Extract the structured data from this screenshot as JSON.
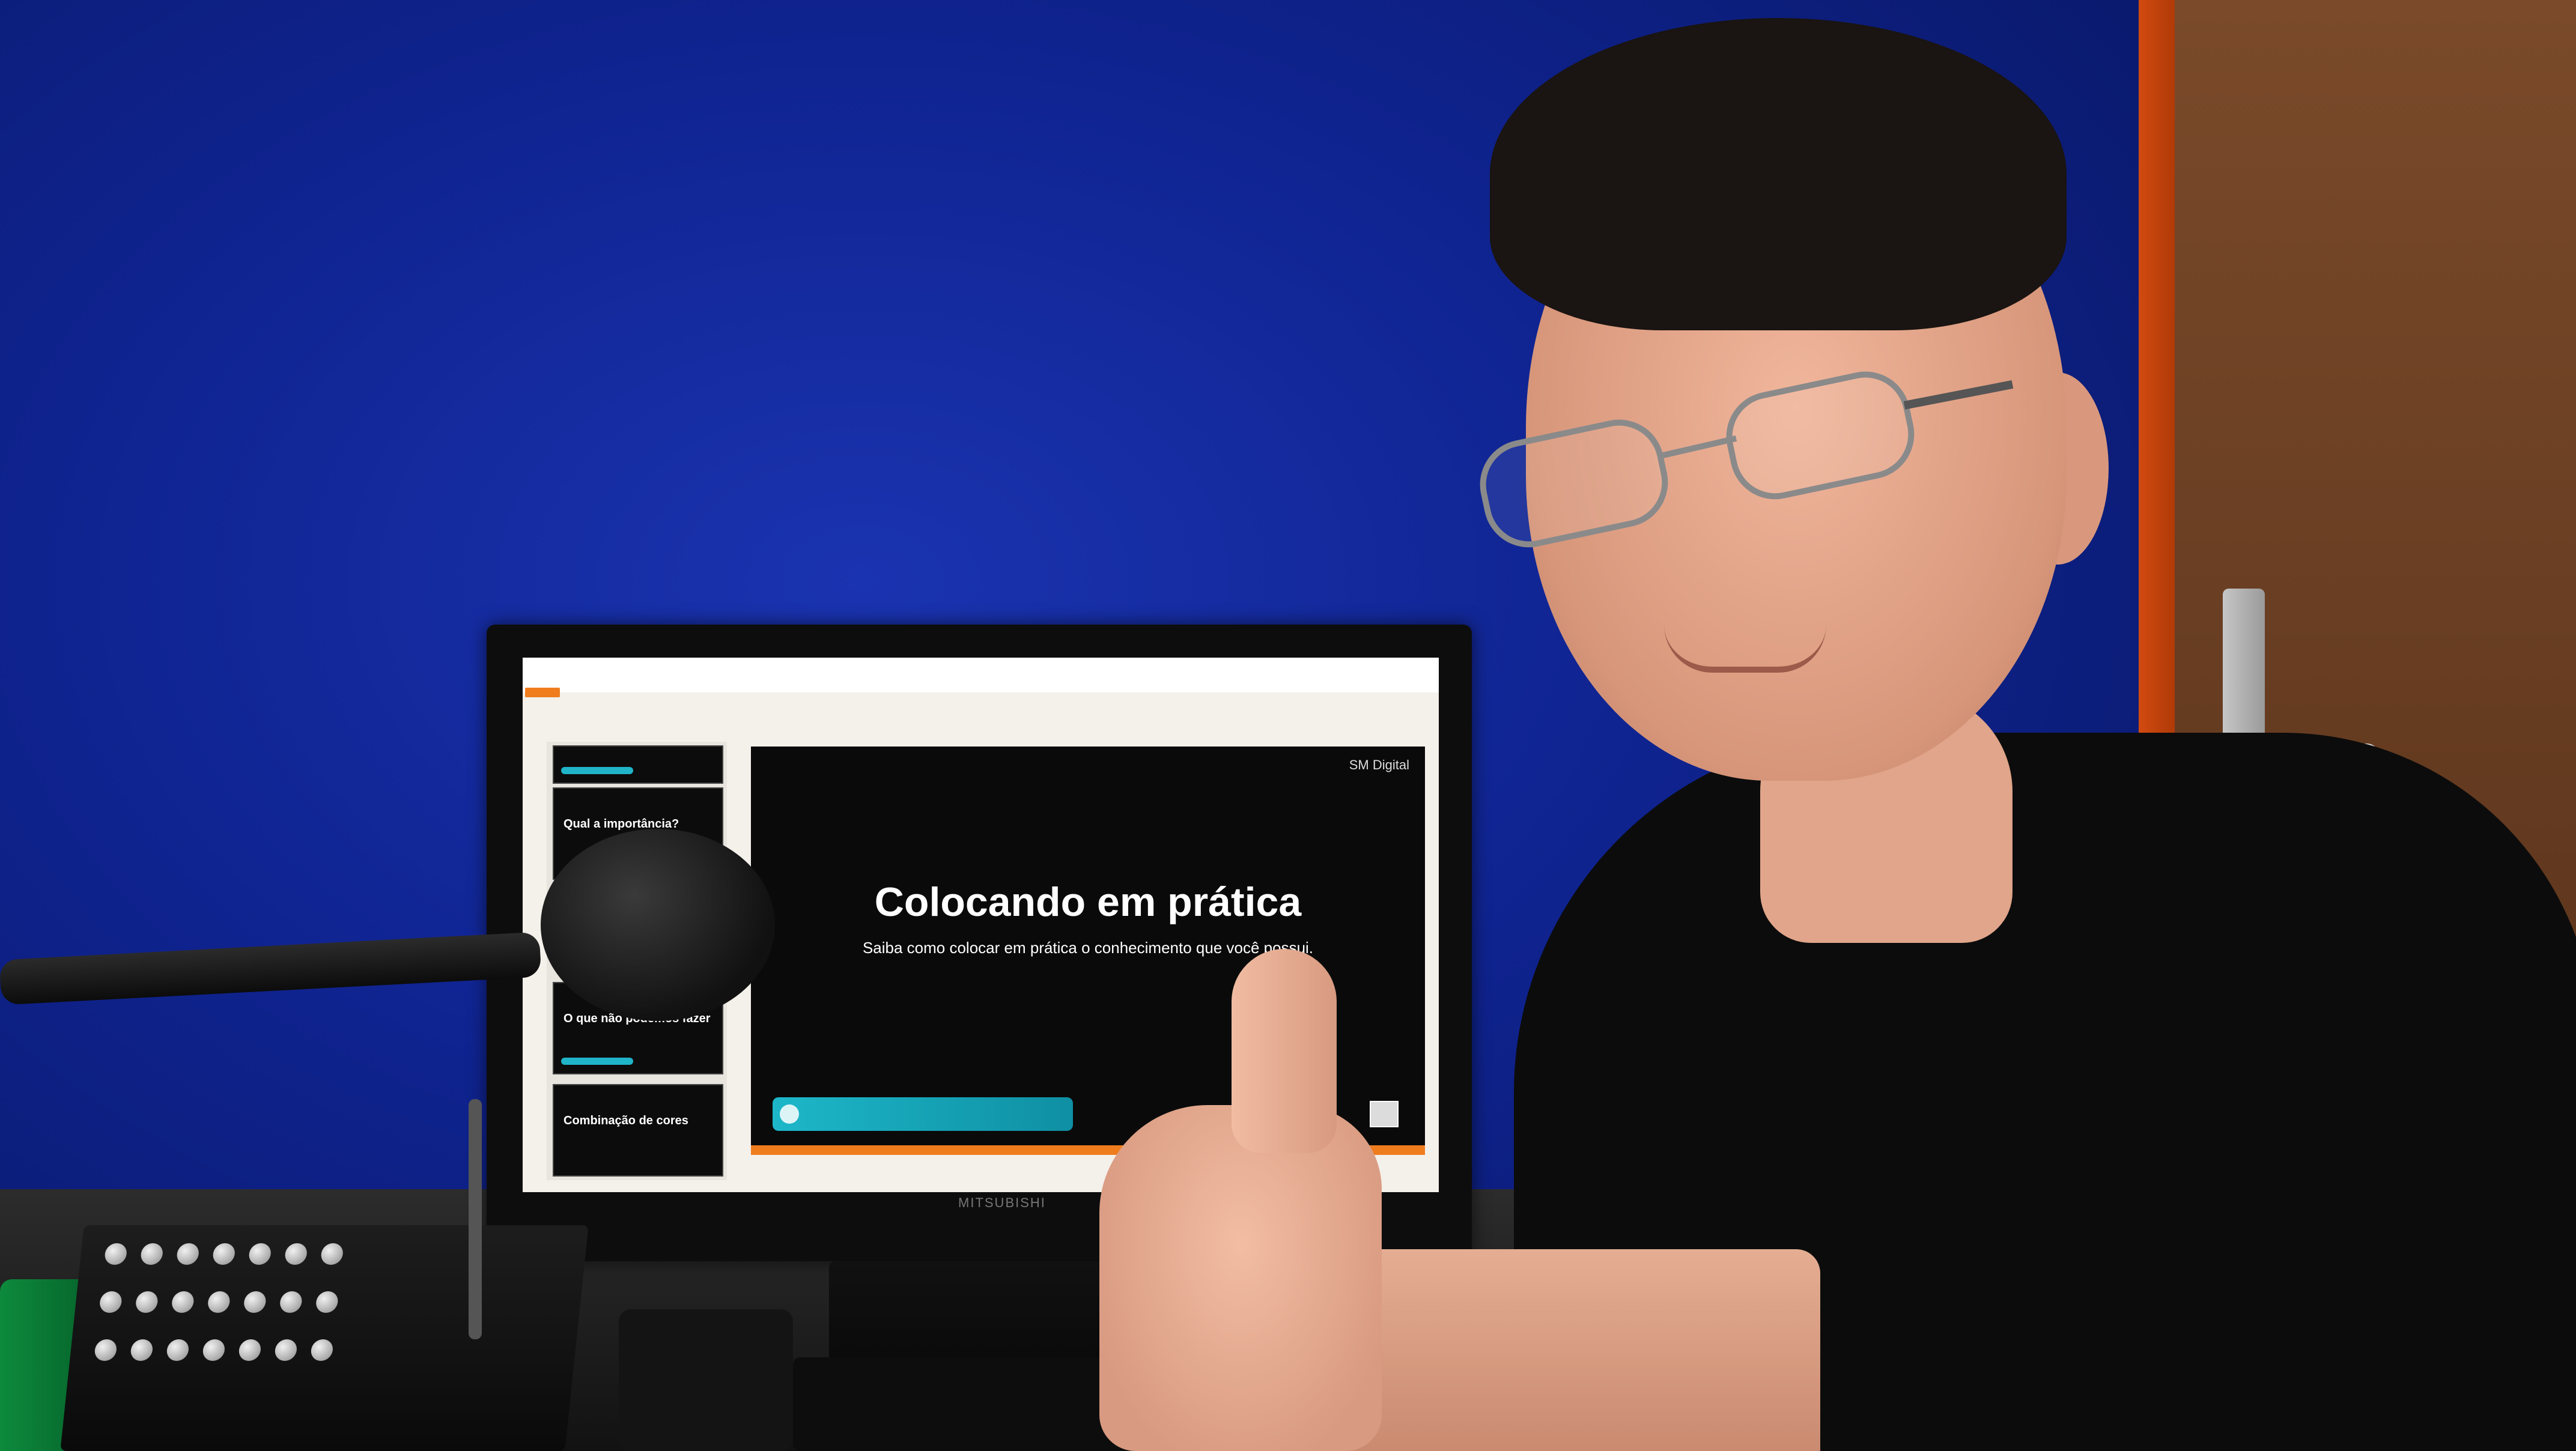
{
  "scene": {
    "slide": {
      "title": "Colocando em prática",
      "subtitle": "Saiba como colocar em prática o conhecimento que você possui.",
      "logo": "SM Digital"
    },
    "sidebar": {
      "thumbs": [
        "Qual a importância?",
        "O que não podemos fazer",
        "Combinação de cores"
      ]
    },
    "monitor_brand": "MITSUBISHI",
    "colors": {
      "wall": "#1a33b0",
      "slide_bg": "#0a0a0a",
      "accent_teal": "#1db7c9",
      "accent_orange": "#ef7d1e"
    }
  }
}
